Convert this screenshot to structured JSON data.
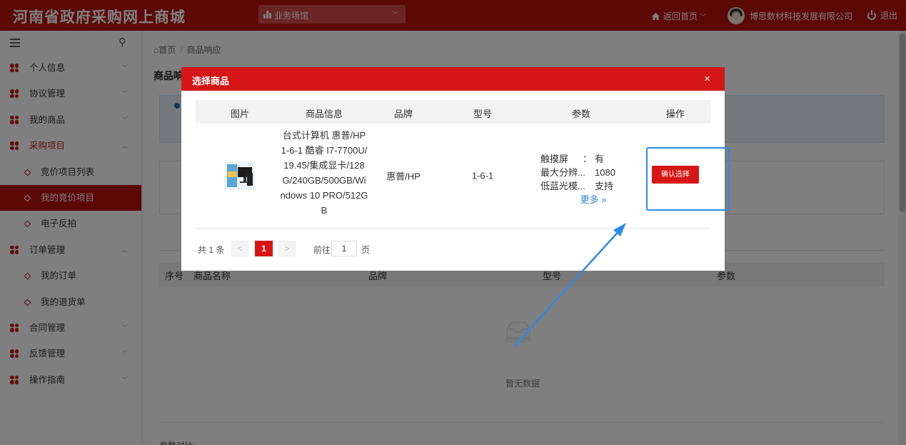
{
  "header": {
    "site_title": "河南省政府采购网上商城",
    "venue_select": "业务场馆",
    "home_link": "返回首页",
    "company": "博思数材科技发展有限公司",
    "logout": "退出"
  },
  "sidebar": {
    "menu": [
      {
        "label": "个人信息"
      },
      {
        "label": "协议管理"
      },
      {
        "label": "我的商品"
      },
      {
        "label": "采购项目"
      },
      {
        "label": "竞价项目列表"
      },
      {
        "label": "我的竞价项目"
      },
      {
        "label": "电子反拍"
      },
      {
        "label": "订单管理"
      },
      {
        "label": "我的订单"
      },
      {
        "label": "我的退货单"
      },
      {
        "label": "合同管理"
      },
      {
        "label": "反馈管理"
      },
      {
        "label": "操作指南"
      }
    ]
  },
  "main": {
    "breadcrumb": {
      "home": "首页",
      "current": "商品响应"
    },
    "page_title": "商品响",
    "table_headers": [
      "序号",
      "商品名称",
      "品牌",
      "型号",
      "参数"
    ],
    "empty_text": "暂无数据",
    "footer_text": "参数对比"
  },
  "modal": {
    "title": "选择商品",
    "close": "×",
    "columns": [
      "图片",
      "商品信息",
      "品牌",
      "型号",
      "参数",
      "操作"
    ],
    "row": {
      "info": "台式计算机 惠普/HP 1-6-1 酷睿 I7-7700U/19.45/集成显卡/128G/240GB/500GB/Windows 10 PRO/512GB",
      "brand": "惠普/HP",
      "model": "1-6-1",
      "params": [
        {
          "key": "触摸屏",
          "sep": "：",
          "value": "有"
        },
        {
          "key": "最大分辨...",
          "value": "1080"
        },
        {
          "key": "低蓝光模...",
          "value": "支持"
        }
      ],
      "more": "更多 »",
      "action": "确认选择"
    },
    "pager": {
      "total": "共 1 条",
      "prev": "<",
      "current": "1",
      "next": ">",
      "goto": "前往",
      "page_input": "1",
      "page_unit": "页"
    }
  },
  "colors": {
    "brand_red": "#b8100f",
    "modal_red": "#d61616",
    "annotation_blue": "#2d8ae6"
  }
}
